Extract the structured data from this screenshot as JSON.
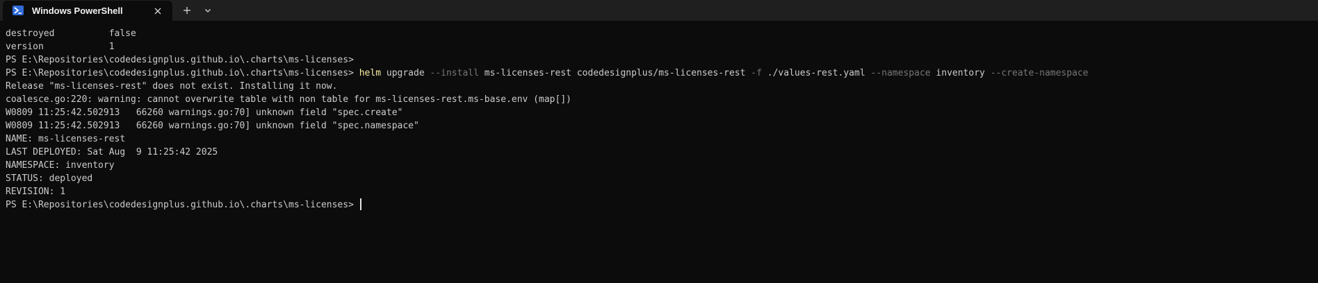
{
  "tab": {
    "title": "Windows PowerShell",
    "icon": "powershell-icon",
    "close_icon": "close-icon"
  },
  "titlebar": {
    "new_tab_icon": "plus-icon",
    "dropdown_icon": "chevron-down-icon"
  },
  "colors": {
    "background": "#0c0c0c",
    "titlebar": "#1f1f1f",
    "text": "#cccccc",
    "command": "#f9f1a5",
    "parameter": "#767676",
    "icon_accent": "#2f6ad8"
  },
  "terminal": {
    "line1": "destroyed          false",
    "line2": "version            1",
    "line3": "PS E:\\Repositories\\codedesignplus.github.io\\.charts\\ms-licenses>",
    "line4": {
      "prompt": "PS E:\\Repositories\\codedesignplus.github.io\\.charts\\ms-licenses> ",
      "cmd": "helm",
      "t1": " upgrade ",
      "p1": "--install",
      "t2": " ms-licenses-rest codedesignplus/ms-licenses-rest ",
      "p2": "-f",
      "t3": " ./values-rest.yaml ",
      "p3": "--namespace",
      "t4": " inventory ",
      "p4": "--create-namespace"
    },
    "line5": "Release \"ms-licenses-rest\" does not exist. Installing it now.",
    "line6": "coalesce.go:220: warning: cannot overwrite table with non table for ms-licenses-rest.ms-base.env (map[])",
    "line7": "W0809 11:25:42.502913   66260 warnings.go:70] unknown field \"spec.create\"",
    "line8": "W0809 11:25:42.502913   66260 warnings.go:70] unknown field \"spec.namespace\"",
    "line9": "NAME: ms-licenses-rest",
    "line10": "LAST DEPLOYED: Sat Aug  9 11:25:42 2025",
    "line11": "NAMESPACE: inventory",
    "line12": "STATUS: deployed",
    "line13": "REVISION: 1",
    "line14": "PS E:\\Repositories\\codedesignplus.github.io\\.charts\\ms-licenses> "
  }
}
